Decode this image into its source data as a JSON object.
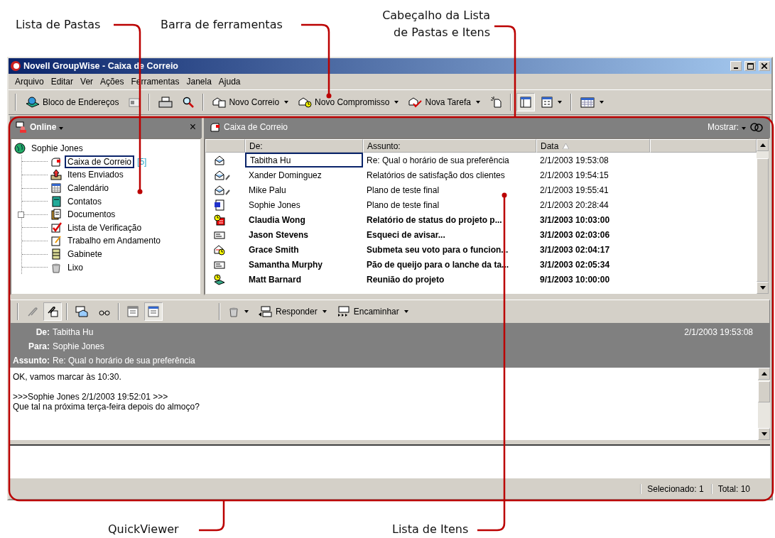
{
  "callouts": [
    {
      "lines": [
        "Lista de Pastas"
      ]
    },
    {
      "lines": [
        "Barra de ferramentas"
      ]
    },
    {
      "lines": [
        "Cabeçalho da Lista",
        "de Pastas e Itens"
      ]
    },
    {
      "lines": [
        "QuickViewer"
      ]
    },
    {
      "lines": [
        "Lista de Itens"
      ]
    }
  ],
  "window": {
    "title": "Novell GroupWise - Caixa de Correio"
  },
  "menu": [
    {
      "label": "Arquivo"
    },
    {
      "label": "Editar"
    },
    {
      "label": "Ver"
    },
    {
      "label": "Ações"
    },
    {
      "label": "Ferramentas"
    },
    {
      "label": "Janela"
    },
    {
      "label": "Ajuda"
    }
  ],
  "toolbar": {
    "address_book": "Bloco de Endereços",
    "buttons": [
      {
        "label": "Novo Correio"
      },
      {
        "label": "Novo Compromisso"
      },
      {
        "label": "Nova Tarefa"
      }
    ],
    "views": [
      {
        "selected": true
      },
      {
        "selected": false
      }
    ]
  },
  "folder_pane": {
    "title": "Online",
    "close": "×",
    "tree": [
      {
        "label": "Sophie Jones",
        "kind": "user",
        "selected": false,
        "children": [
          {
            "label": "Caixa de Correio",
            "kind": "mailbox",
            "selected": true,
            "has_children": false,
            "count": "[5]"
          },
          {
            "label": "Itens Enviados",
            "kind": "sent",
            "selected": false,
            "has_children": false
          },
          {
            "label": "Calendário",
            "kind": "calendar",
            "selected": false,
            "has_children": false
          },
          {
            "label": "Contatos",
            "kind": "contacts",
            "selected": false,
            "has_children": false
          },
          {
            "label": "Documentos",
            "kind": "documents",
            "selected": false,
            "has_children": true
          },
          {
            "label": "Lista de Verificação",
            "kind": "checklist",
            "selected": false,
            "has_children": false
          },
          {
            "label": "Trabalho em Andamento",
            "kind": "work",
            "selected": false,
            "has_children": false
          },
          {
            "label": "Gabinete",
            "kind": "cabinet",
            "selected": false,
            "has_children": false
          },
          {
            "label": "Lixo",
            "kind": "trash",
            "selected": false,
            "has_children": false
          }
        ]
      }
    ]
  },
  "item_list": {
    "title": "Caixa de Correio",
    "filter": "Mostrar:",
    "columns": [
      {
        "label": "De:",
        "sorted": false
      },
      {
        "label": "Assunto:",
        "sorted": false
      },
      {
        "label": "Data",
        "sorted": true
      }
    ],
    "rows": [
      {
        "kind": "opened",
        "from": "Tabitha Hu",
        "subject": "Re: Qual o horário de sua preferência",
        "date": "2/1/2003 19:53:08",
        "unread": false,
        "selected": true
      },
      {
        "kind": "opened-attachment",
        "from": "Xander Dominguez",
        "subject": "Relatórios de satisfação dos clientes",
        "date": "2/1/2003 19:54:15",
        "unread": false,
        "selected": false
      },
      {
        "kind": "opened-attachment",
        "from": "Mike Palu",
        "subject": "Plano de teste final",
        "date": "2/1/2003 19:55:41",
        "unread": false,
        "selected": false
      },
      {
        "kind": "document",
        "from": "Sophie Jones",
        "subject": "Plano de teste final",
        "date": "2/1/2003 20:28:44",
        "unread": false,
        "selected": false
      },
      {
        "kind": "task",
        "from": "Claudia Wong",
        "subject": "Relatório de status do projeto p...",
        "date": "3/1/2003 10:03:00",
        "unread": true,
        "selected": false
      },
      {
        "kind": "mail",
        "from": "Jason Stevens",
        "subject": "Esqueci de avisar...",
        "date": "3/1/2003 02:03:06",
        "unread": true,
        "selected": false
      },
      {
        "kind": "appointment",
        "from": "Grace Smith",
        "subject": "Submeta seu voto para o funcion...",
        "date": "3/1/2003 02:04:17",
        "unread": true,
        "selected": false
      },
      {
        "kind": "mail",
        "from": "Samantha Murphy",
        "subject": "Pão de queijo para o lanche da ta...",
        "date": "3/1/2003 02:05:34",
        "unread": true,
        "selected": false
      },
      {
        "kind": "note",
        "from": "Matt Barnard",
        "subject": "Reunião do projeto",
        "date": "9/1/2003 10:00:00",
        "unread": true,
        "selected": false
      }
    ]
  },
  "quickviewer": {
    "toggles": [
      {
        "selected": false
      },
      {
        "selected": true
      },
      {
        "selected": false
      },
      {
        "selected": false
      },
      {
        "selected": false
      },
      {
        "selected": true
      }
    ],
    "buttons": [
      {
        "label": "Responder"
      },
      {
        "label": "Encaminhar"
      }
    ],
    "fields": [
      {
        "label": "De:",
        "value": "Tabitha Hu"
      },
      {
        "label": "Para:",
        "value": "Sophie Jones"
      },
      {
        "label": "Assunto:",
        "value": "Re: Qual o horário de sua preferência"
      }
    ],
    "date": "2/1/2003 19:53:08",
    "body": [
      {
        "lines": [
          "OK, vamos marcar às 10:30."
        ]
      },
      {
        "lines": [
          ">>>Sophie Jones 2/1/2003 19:52:01 >>>",
          "Que tal na próxima terça-feira depois do almoço?"
        ]
      }
    ]
  },
  "status_bar": [
    "Selecionado: 1",
    "Total: 10"
  ]
}
